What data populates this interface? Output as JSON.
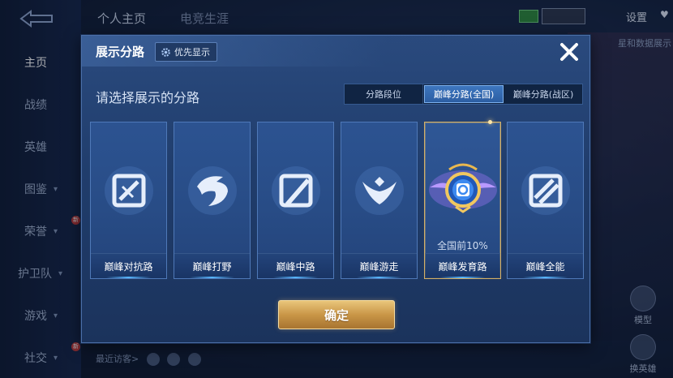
{
  "background": {
    "top_tabs": [
      "个人主页",
      "电竞生涯"
    ],
    "settings_label": "设置",
    "side_nav": [
      {
        "label": "主页",
        "active": true
      },
      {
        "label": "战绩"
      },
      {
        "label": "英雄"
      },
      {
        "label": "图鉴",
        "has_chevron": true
      },
      {
        "label": "荣誉",
        "has_chevron": true,
        "badge": "新"
      },
      {
        "label": "护卫队",
        "has_chevron": true
      },
      {
        "label": "游戏",
        "has_chevron": true
      },
      {
        "label": "社交",
        "has_chevron": true,
        "badge": "新"
      }
    ],
    "right_text": "星和数据展示",
    "right_buttons": [
      "模型",
      "换英雄"
    ],
    "bottom_text": "最近访客>"
  },
  "dialog": {
    "title": "展示分路",
    "priority_button": "优先显示",
    "prompt": "请选择展示的分路",
    "segments": [
      {
        "label": "分路段位",
        "active": false
      },
      {
        "label": "巅峰分路(全国)",
        "active": true
      },
      {
        "label": "巅峰分路(战区)",
        "active": false
      }
    ],
    "cards": [
      {
        "label": "巅峰对抗路",
        "icon": "sword-shield-icon",
        "selected": false
      },
      {
        "label": "巅峰打野",
        "icon": "dragon-icon",
        "selected": false
      },
      {
        "label": "巅峰中路",
        "icon": "staff-icon",
        "selected": false
      },
      {
        "label": "巅峰游走",
        "icon": "wings-icon",
        "selected": false
      },
      {
        "label": "巅峰发育路",
        "icon": "marksman-emblem-icon",
        "selected": true,
        "rank": "全国前10%"
      },
      {
        "label": "巅峰全能",
        "icon": "all-round-icon",
        "selected": false
      }
    ],
    "confirm_button": "确定",
    "colors": {
      "accent_gold": "#d4b067",
      "panel_blue": "#203d6c",
      "active_segment": "#3d76bf"
    }
  }
}
